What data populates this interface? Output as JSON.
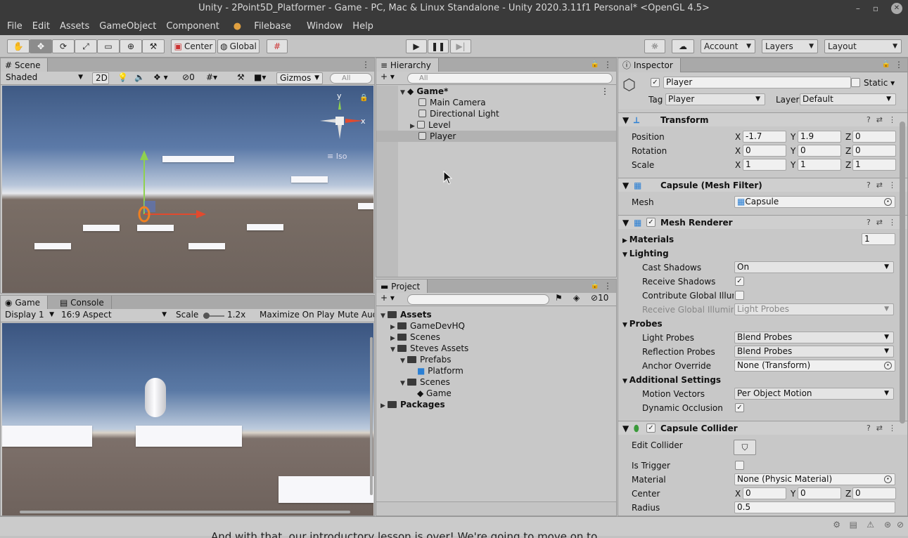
{
  "window": {
    "title": "Unity - 2Point5D_Platformer - Game - PC, Mac & Linux Standalone - Unity 2020.3.11f1 Personal* <OpenGL 4.5>",
    "min": "–",
    "max": "▫",
    "close": "✕"
  },
  "menu": [
    "File",
    "Edit",
    "Assets",
    "GameObject",
    "Component",
    "Filebase",
    "Window",
    "Help"
  ],
  "toolbar": {
    "center": "Center",
    "global": "Global",
    "account": "Account",
    "layers": "Layers",
    "layout": "Layout"
  },
  "scene": {
    "tab": "Scene",
    "shading": "Shaded",
    "twod": "2D",
    "hidden_count": "0",
    "gizmos": "Gizmos",
    "search": "All",
    "iso": "Iso",
    "axis_y": "y",
    "axis_x": "x"
  },
  "game": {
    "tab": "Game",
    "console_tab": "Console",
    "display": "Display 1",
    "aspect": "16:9 Aspect",
    "scale_label": "Scale",
    "scale_value": "1.2x",
    "maximize": "Maximize On Play",
    "mute": "Mute Aud"
  },
  "hierarchy": {
    "tab": "Hierarchy",
    "search": "All",
    "scene": "Game*",
    "items": [
      "Main Camera",
      "Directional Light",
      "Level",
      "Player"
    ]
  },
  "project": {
    "tab": "Project",
    "count": "10",
    "tree": [
      "Assets",
      "GameDevHQ",
      "Scenes",
      "Steves Assets",
      "Prefabs",
      "Platform",
      "Scenes",
      "Game",
      "Packages"
    ]
  },
  "inspector": {
    "tab": "Inspector",
    "object_name": "Player",
    "static_label": "Static",
    "tag_label": "Tag",
    "tag_value": "Player",
    "layer_label": "Layer",
    "layer_value": "Default",
    "transform": {
      "title": "Transform",
      "position": "Position",
      "rotation": "Rotation",
      "scale": "Scale",
      "pos": [
        "-1.7",
        "1.9",
        "0"
      ],
      "rot": [
        "0",
        "0",
        "0"
      ],
      "scl": [
        "1",
        "1",
        "1"
      ],
      "x": "X",
      "y": "Y",
      "z": "Z"
    },
    "meshfilter": {
      "title": "Capsule (Mesh Filter)",
      "mesh_label": "Mesh",
      "mesh_value": "Capsule"
    },
    "meshrenderer": {
      "title": "Mesh Renderer",
      "materials": "Materials",
      "materials_count": "1",
      "lighting": "Lighting",
      "cast_shadows": "Cast Shadows",
      "cast_value": "On",
      "receive_shadows": "Receive Shadows",
      "contribute": "Contribute Global Illumi",
      "receive_gi": "Receive Global Illumina",
      "receive_gi_value": "Light Probes",
      "probes": "Probes",
      "light_probes": "Light Probes",
      "light_probes_value": "Blend Probes",
      "reflection_probes": "Reflection Probes",
      "reflection_value": "Blend Probes",
      "anchor": "Anchor Override",
      "anchor_value": "None (Transform)",
      "additional": "Additional Settings",
      "motion_vectors": "Motion Vectors",
      "motion_value": "Per Object Motion",
      "dynamic_occlusion": "Dynamic Occlusion"
    },
    "collider": {
      "title": "Capsule Collider",
      "edit": "Edit Collider",
      "is_trigger": "Is Trigger",
      "material": "Material",
      "material_value": "None (Physic Material)",
      "center": "Center",
      "center_vals": [
        "0",
        "0",
        "0"
      ],
      "radius": "Radius",
      "radius_value": "0.5"
    }
  },
  "subtitle": "And with that, our introductory lesson is over! We're going to move on to"
}
